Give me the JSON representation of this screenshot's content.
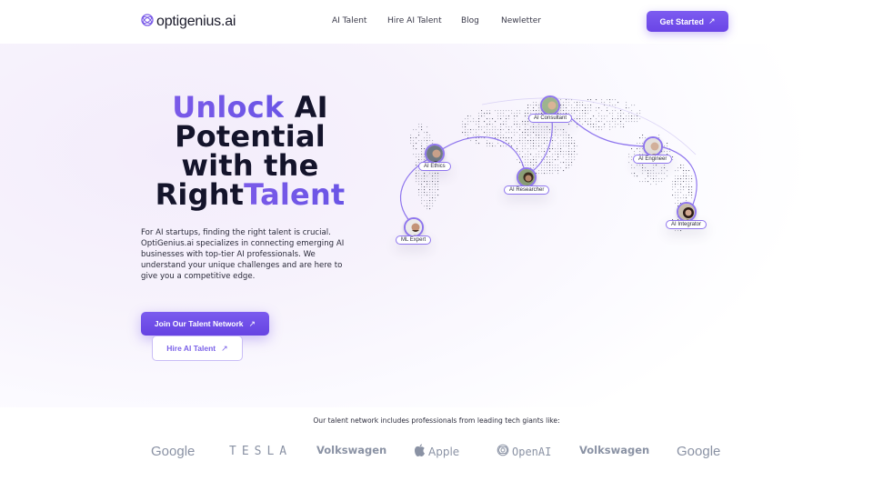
{
  "header": {
    "brand": "optigenius.ai",
    "nav": [
      "AI Talent",
      "Hire AI Talent",
      "Blog",
      "Newletter"
    ],
    "cta_label": "Get Started"
  },
  "hero": {
    "title": {
      "part1_accent": "Unlock",
      "part1_rest": " AI",
      "line2": "Potential",
      "line3": "with the",
      "line4_plain": "Right",
      "line4_accent": "Talent"
    },
    "description": "For AI startups, finding the right talent is crucial. OptiGenius.ai specializes in connecting emerging AI businesses with top-tier AI professionals. We understand your unique challenges and are here to give you a competitive edge.",
    "primary_button": "Join Our Talent Network",
    "secondary_button": "Hire AI Talent"
  },
  "map": {
    "nodes": [
      {
        "label": "AI Consultant",
        "tone": "#6d8a6a"
      },
      {
        "label": "AI Ethics",
        "tone": "#4a5560"
      },
      {
        "label": "AI Researcher",
        "tone": "#5c4a3a"
      },
      {
        "label": "AI Engineer",
        "tone": "#8a7a6a"
      },
      {
        "label": "ML Expert",
        "tone": "#6a5040"
      },
      {
        "label": "AI Integrator",
        "tone": "#3a2a24"
      }
    ]
  },
  "partners": {
    "caption": "Our talent network includes professionals from leading tech giants like:",
    "logos": [
      "Google",
      "TESLA",
      "Volkswagen",
      "Apple",
      "OpenAI",
      "Volkswagen",
      "Google"
    ]
  },
  "colors": {
    "accent": "#7358e8",
    "button_gradient_top": "#7a5bee",
    "button_gradient_bottom": "#6643e2",
    "logo_gray": "#8a92a4"
  }
}
